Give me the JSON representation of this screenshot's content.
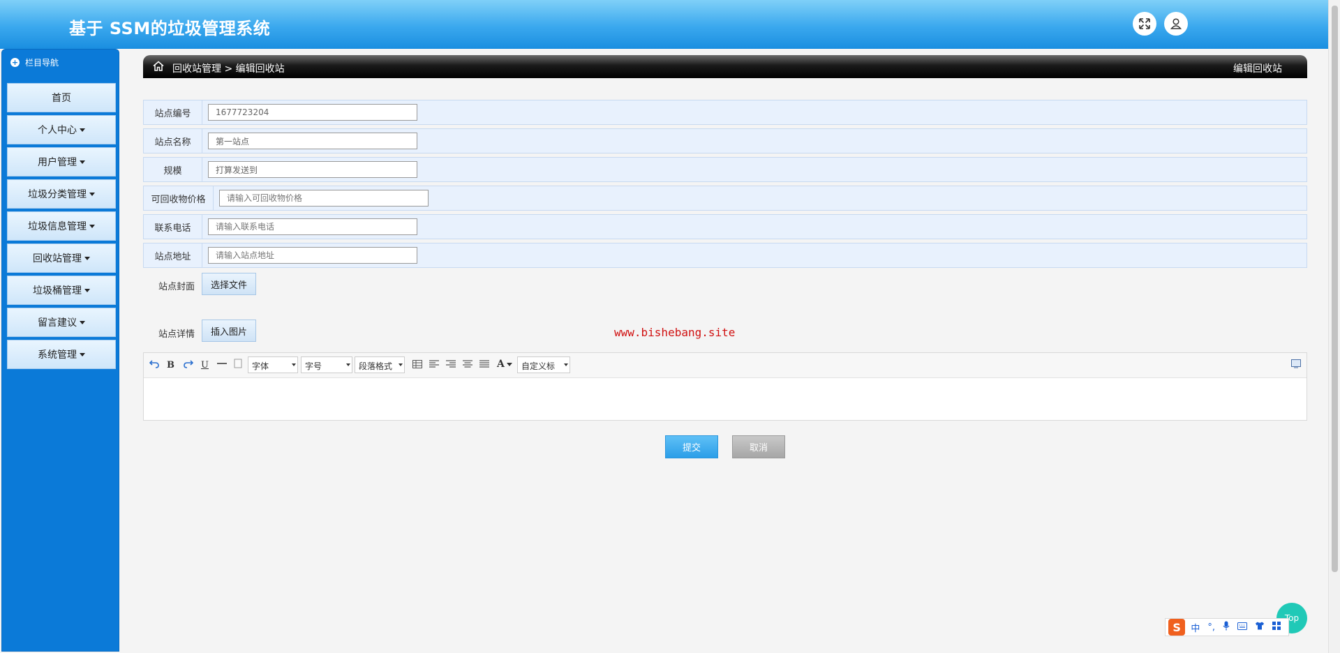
{
  "header": {
    "title": "基于 SSM的垃圾管理系统"
  },
  "sidebar": {
    "heading": "栏目导航",
    "items": [
      {
        "label": "首页",
        "dropdown": false
      },
      {
        "label": "个人中心",
        "dropdown": true
      },
      {
        "label": "用户管理",
        "dropdown": true
      },
      {
        "label": "垃圾分类管理",
        "dropdown": true
      },
      {
        "label": "垃圾信息管理",
        "dropdown": true
      },
      {
        "label": "回收站管理",
        "dropdown": true
      },
      {
        "label": "垃圾桶管理",
        "dropdown": true
      },
      {
        "label": "留言建议",
        "dropdown": true
      },
      {
        "label": "系统管理",
        "dropdown": true
      }
    ]
  },
  "breadcrumb": {
    "path": "回收站管理 > 编辑回收站",
    "right_title": "编辑回收站"
  },
  "form": {
    "site_no": {
      "label": "站点编号",
      "value": "1677723204"
    },
    "site_name": {
      "label": "站点名称",
      "value": "第一站点"
    },
    "scale": {
      "label": "规模",
      "value": "打算发送到"
    },
    "price": {
      "label": "可回收物价格",
      "placeholder": "请输入可回收物价格"
    },
    "phone": {
      "label": "联系电话",
      "placeholder": "请输入联系电话"
    },
    "address": {
      "label": "站点地址",
      "placeholder": "请输入站点地址"
    },
    "cover": {
      "label": "站点封面",
      "button": "选择文件"
    },
    "detail": {
      "label": "站点详情",
      "button": "插入图片"
    }
  },
  "watermark": "www.bishebang.site",
  "editor": {
    "toolbar": {
      "bold": "B",
      "underline": "U",
      "font_family": "字体",
      "font_size": "字号",
      "paragraph": "段落格式",
      "font_color": "A",
      "custom_title": "自定义标"
    }
  },
  "actions": {
    "submit": "提交",
    "cancel": "取消"
  },
  "back_to_top": "Top",
  "ime": {
    "logo": "S",
    "mode": "中",
    "punct": "°,"
  },
  "colors": {
    "header": "#3aa8ee",
    "sidebar": "#0b7ad8",
    "submit": "#2b9ee8",
    "top_button": "#20c9b7"
  }
}
